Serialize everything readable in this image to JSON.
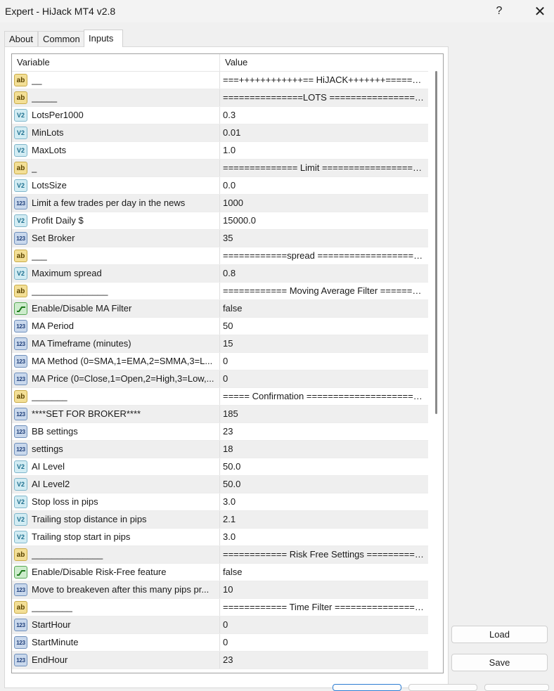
{
  "window": {
    "title": "Expert - HiJack MT4 v2.8",
    "help_glyph": "?",
    "close_glyph": "✕"
  },
  "tabs": [
    {
      "label": "About"
    },
    {
      "label": "Common"
    },
    {
      "label": "Inputs"
    }
  ],
  "grid": {
    "headers": {
      "variable": "Variable",
      "value": "Value"
    },
    "rows": [
      {
        "icon": "string-icon",
        "variable": "__",
        "value": "===++++++++++++== HiJACK+++++++========..."
      },
      {
        "icon": "string-icon",
        "variable": "_____",
        "value": "===============LOTS ====================..."
      },
      {
        "icon": "double-icon",
        "variable": "LotsPer1000",
        "value": "0.3"
      },
      {
        "icon": "double-icon",
        "variable": "MinLots",
        "value": "0.01"
      },
      {
        "icon": "double-icon",
        "variable": "MaxLots",
        "value": "1.0"
      },
      {
        "icon": "string-icon",
        "variable": "_",
        "value": "============== Limit ====================..."
      },
      {
        "icon": "double-icon",
        "variable": "LotsSize",
        "value": "0.0"
      },
      {
        "icon": "integer-icon",
        "variable": "Limit a few trades per day in the news",
        "value": "1000"
      },
      {
        "icon": "double-icon",
        "variable": "Profit Daily $",
        "value": "15000.0"
      },
      {
        "icon": "integer-icon",
        "variable": "Set Broker",
        "value": "35"
      },
      {
        "icon": "string-icon",
        "variable": "___",
        "value": "============spread ====================..."
      },
      {
        "icon": "double-icon",
        "variable": "Maximum spread",
        "value": "0.8"
      },
      {
        "icon": "string-icon",
        "variable": "_______________",
        "value": "============ Moving Average Filter ========..."
      },
      {
        "icon": "bool-icon",
        "variable": "Enable/Disable MA Filter",
        "value": "false"
      },
      {
        "icon": "integer-icon",
        "variable": "MA Period",
        "value": "50"
      },
      {
        "icon": "integer-icon",
        "variable": "MA Timeframe (minutes)",
        "value": "15"
      },
      {
        "icon": "integer-icon",
        "variable": "MA Method (0=SMA,1=EMA,2=SMMA,3=L...",
        "value": "0"
      },
      {
        "icon": "integer-icon",
        "variable": "MA Price (0=Close,1=Open,2=High,3=Low,...",
        "value": "0"
      },
      {
        "icon": "string-icon",
        "variable": "_______",
        "value": "===== Confirmation =======================..."
      },
      {
        "icon": "integer-icon",
        "variable": "****SET FOR BROKER****",
        "value": "185"
      },
      {
        "icon": "integer-icon",
        "variable": "BB settings",
        "value": "23"
      },
      {
        "icon": "integer-icon",
        "variable": "settings",
        "value": "18"
      },
      {
        "icon": "double-icon",
        "variable": "AI Level",
        "value": "50.0"
      },
      {
        "icon": "double-icon",
        "variable": "AI Level2",
        "value": "50.0"
      },
      {
        "icon": "double-icon",
        "variable": "Stop loss in pips",
        "value": "3.0"
      },
      {
        "icon": "double-icon",
        "variable": "Trailing stop distance in pips",
        "value": "2.1"
      },
      {
        "icon": "double-icon",
        "variable": "Trailing stop start in pips",
        "value": "3.0"
      },
      {
        "icon": "string-icon",
        "variable": "______________",
        "value": "============ Risk Free Settings ===========..."
      },
      {
        "icon": "bool-icon",
        "variable": "Enable/Disable Risk-Free feature",
        "value": "false"
      },
      {
        "icon": "integer-icon",
        "variable": "Move to breakeven after this many pips pr...",
        "value": "10"
      },
      {
        "icon": "string-icon",
        "variable": "________",
        "value": "============ Time Filter =================..."
      },
      {
        "icon": "integer-icon",
        "variable": "StartHour",
        "value": "0"
      },
      {
        "icon": "integer-icon",
        "variable": "StartMinute",
        "value": "0"
      },
      {
        "icon": "integer-icon",
        "variable": "EndHour",
        "value": "23"
      }
    ]
  },
  "buttons": {
    "load": "Load",
    "save": "Save"
  },
  "icon_glyphs": {
    "string-icon": "ab",
    "double-icon": "V2",
    "integer-icon": "123"
  },
  "colors": {
    "alt_row": "#efefef",
    "border": "#a0a0a0",
    "ok_button_border": "#2d7dd2"
  }
}
